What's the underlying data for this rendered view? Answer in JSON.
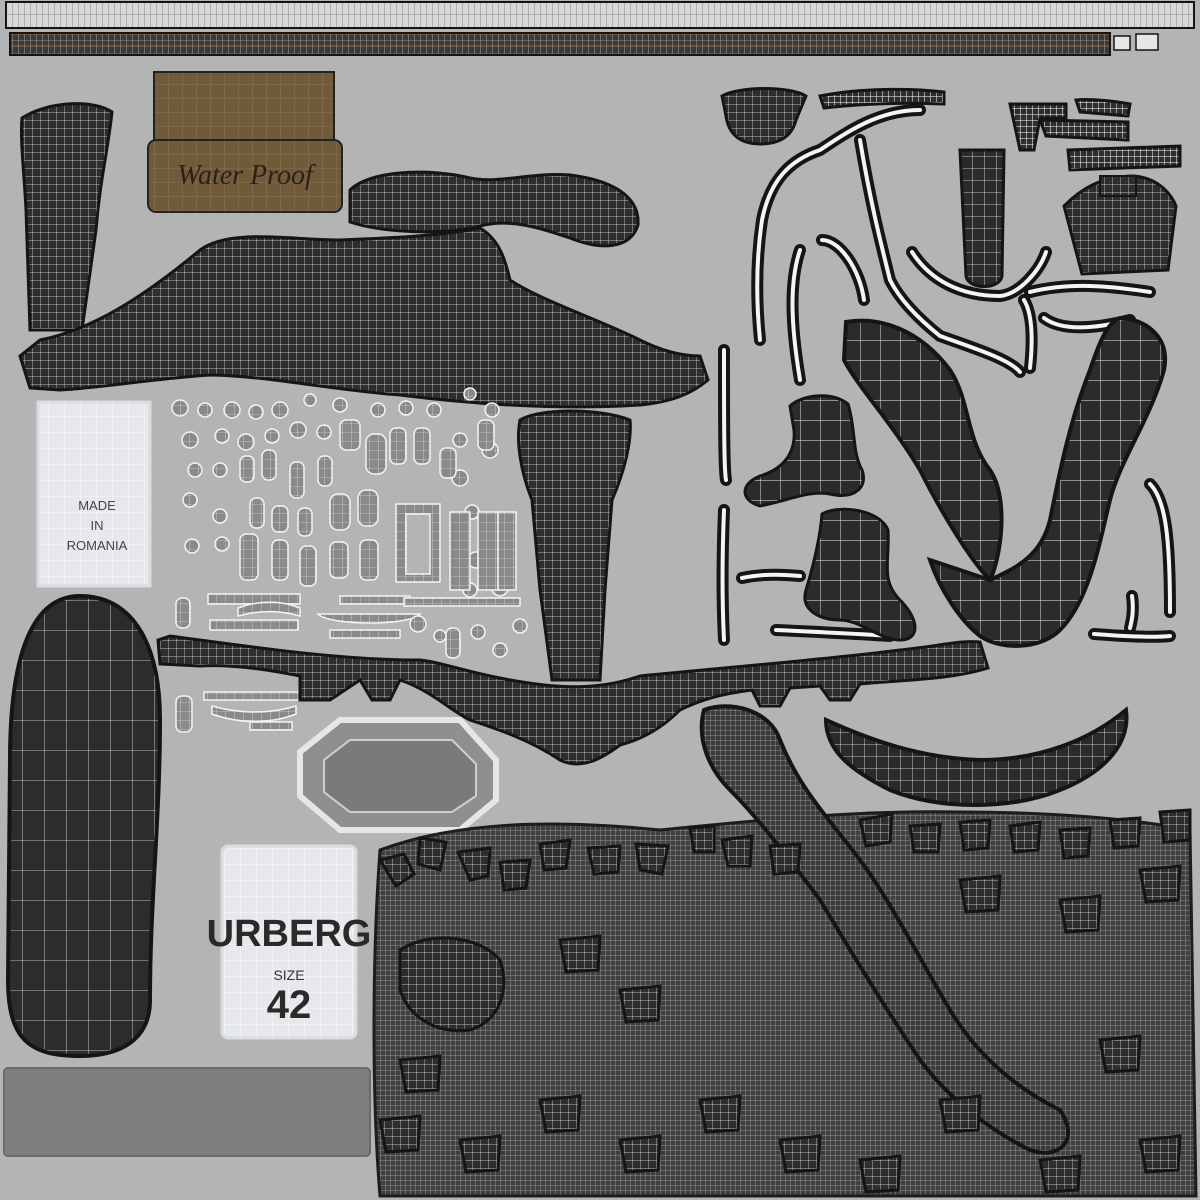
{
  "colors": {
    "background": "#b4b4b4",
    "island_dark": "#2e2e2e",
    "island_outline": "#151515",
    "wire": "#f2f2f2",
    "label_paper": "#e6e8ec",
    "leather": "#6f5a3a",
    "orange_strip": "#c8742e"
  },
  "labels": {
    "waterproof": "Water Proof",
    "made": "MADE",
    "in": "IN",
    "country": "ROMANIA",
    "brand": "URBERG",
    "size_label": "SIZE",
    "size_value": "42"
  }
}
